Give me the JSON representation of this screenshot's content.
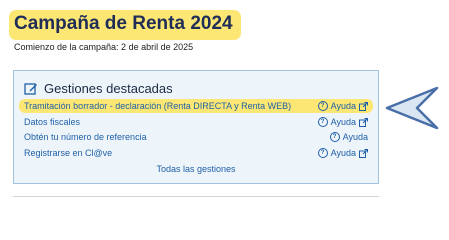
{
  "header": {
    "title": "Campaña de Renta 2024",
    "subtitle": "Comienzo de la campaña: 2 de abril de 2025"
  },
  "panel": {
    "title": "Gestiones destacadas",
    "items": [
      {
        "label": "Tramitación borrador - declaración (Renta DIRECTA y Renta WEB)",
        "help": "Ayuda",
        "external": true,
        "highlighted": true
      },
      {
        "label": "Datos fiscales",
        "help": "Ayuda",
        "external": true,
        "highlighted": false
      },
      {
        "label": "Obtén tu número de referencia",
        "help": "Ayuda",
        "external": false,
        "highlighted": false
      },
      {
        "label": "Registrarse en Cl@ve",
        "help": "Ayuda",
        "external": true,
        "highlighted": false
      }
    ],
    "all_link": "Todas las gestiones"
  },
  "colors": {
    "highlight": "#fce774",
    "link": "#1f5fa8",
    "panel_bg": "#eef5fa",
    "arrow": "#4a6fa8"
  },
  "icons": {
    "panel": "edit-icon",
    "help": "question-circle-icon",
    "external": "external-link-icon",
    "pointer": "arrow-pointer-icon"
  }
}
